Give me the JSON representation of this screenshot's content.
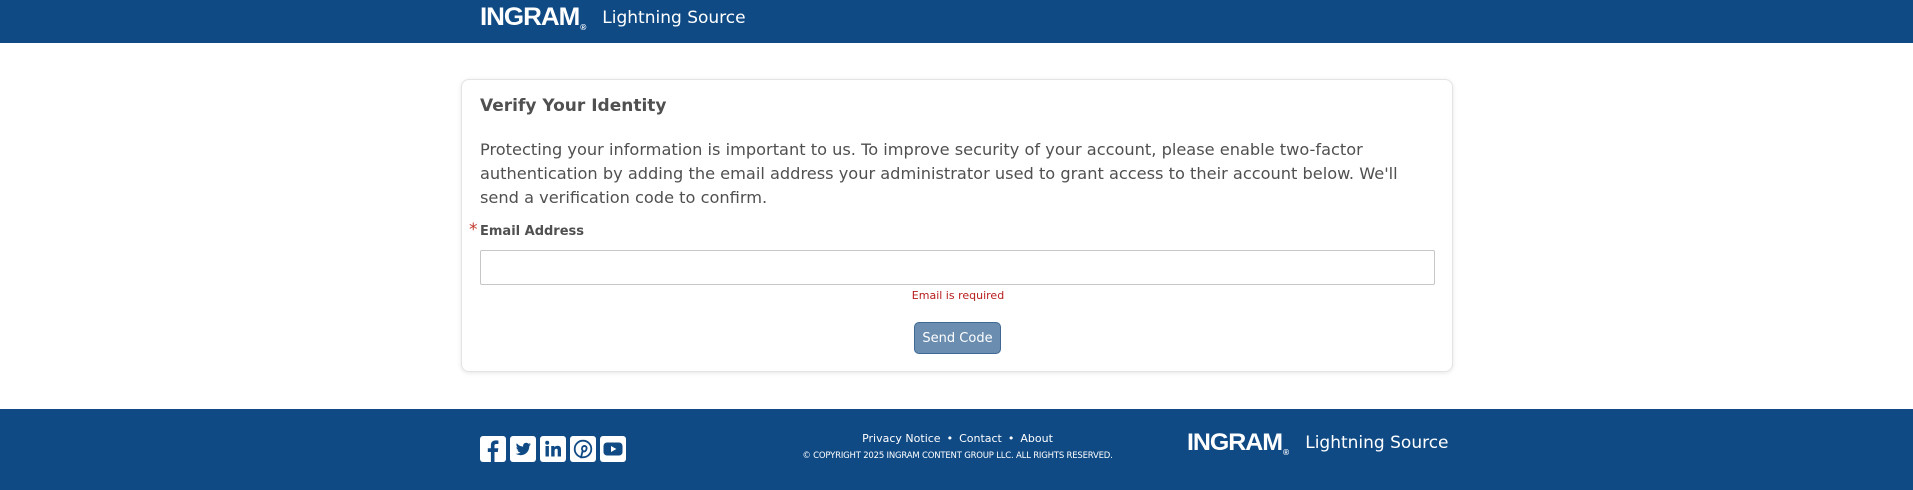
{
  "header": {
    "logo_text": "INGRAM",
    "logo_mark": "®",
    "product_name": "Lightning Source"
  },
  "verify": {
    "title": "Verify Your Identity",
    "description": "Protecting your information is important to us. To improve security of your account, please enable two-factor authentication by adding the email address your administrator used to grant access to their account below. We'll send a verification code to confirm.",
    "required_marker": "*",
    "email_label": "Email Address",
    "email_value": "",
    "email_placeholder": "",
    "error_message": "Email is required",
    "send_button_label": "Send Code"
  },
  "footer": {
    "social_icons": [
      "facebook-icon",
      "twitter-icon",
      "linkedin-icon",
      "pinterest-icon",
      "youtube-icon"
    ],
    "links": {
      "privacy": "Privacy Notice",
      "separator": "•",
      "contact": "Contact",
      "about": "About"
    },
    "copyright": "© COPYRIGHT 2025 INGRAM CONTENT GROUP LLC. ALL RIGHTS RESERVED.",
    "logo_text": "INGRAM",
    "logo_mark": "®",
    "product_name": "Lightning Source"
  },
  "colors": {
    "brand_blue": "#0f4a85",
    "button_blue": "#6a8db0",
    "error_red": "#b81c1c"
  }
}
